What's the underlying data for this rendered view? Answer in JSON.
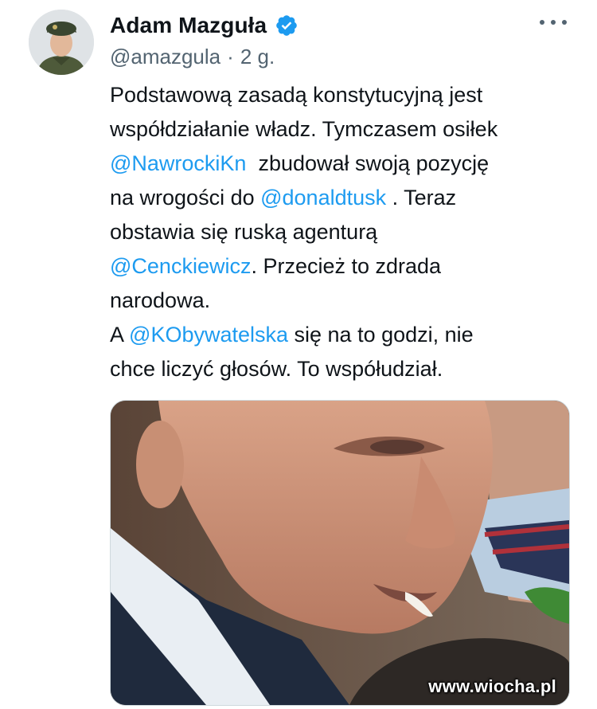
{
  "author": {
    "name": "Adam Mazguła",
    "handle": "@amazgula",
    "separator": "·",
    "time": "2 g."
  },
  "icons": {
    "verified": "verified-badge-icon",
    "more": "more-options-icon"
  },
  "colors": {
    "mention": "#1d9bf0",
    "secondary_text": "#536471",
    "verified_badge": "#1d9bf0"
  },
  "tweet": {
    "lines": [
      [
        {
          "t": "Podstawową zasadą konstytucyjną jest"
        }
      ],
      [
        {
          "t": "współdziałanie władz. Tymczasem osiłek"
        }
      ],
      [
        {
          "t": "@NawrockiKn",
          "m": true
        },
        {
          "t": "  zbudował swoją pozycję"
        }
      ],
      [
        {
          "t": "na wrogości do "
        },
        {
          "t": "@donaldtusk",
          "m": true
        },
        {
          "t": " . Teraz"
        }
      ],
      [
        {
          "t": "obstawia się ruską agenturą"
        }
      ],
      [
        {
          "t": "@Cenckiewicz",
          "m": true
        },
        {
          "t": ". Przecież to zdrada"
        }
      ],
      [
        {
          "t": "narodowa."
        }
      ],
      [
        {
          "t": "A "
        },
        {
          "t": "@KObywatelska",
          "m": true
        },
        {
          "t": " się na to godzi, nie"
        }
      ],
      [
        {
          "t": "chce liczyć głosów. To współudział."
        }
      ]
    ]
  },
  "watermark": "www.wiocha.pl"
}
